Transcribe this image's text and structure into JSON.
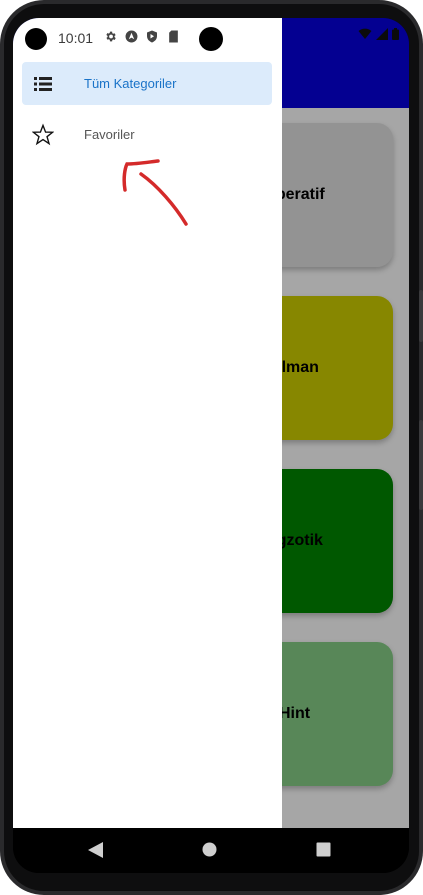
{
  "status_bar": {
    "time": "10:01",
    "left_icons": [
      "settings-icon",
      "navigation-icon",
      "shield-icon",
      "play-protect-icon",
      "sd-card-icon"
    ],
    "right_icons": [
      "wifi-icon",
      "signal-icon",
      "battery-icon"
    ]
  },
  "drawer": {
    "items": [
      {
        "label": "Tüm Kategoriler",
        "icon": "list-icon",
        "active": true
      },
      {
        "label": "Favoriler",
        "icon": "star-icon",
        "active": false
      }
    ]
  },
  "categories": [
    {
      "label": "Aperatif",
      "color": "#d9d9d9"
    },
    {
      "label": "Alman",
      "color": "#c8c800"
    },
    {
      "label": "Egzotik",
      "color": "#008200"
    },
    {
      "label": "Hint",
      "color": "#82c882"
    }
  ],
  "colors": {
    "app_bar": "#0600d6",
    "drawer_active_bg": "#dcebfb",
    "drawer_active_text": "#1a73c8",
    "annotation": "#d42a2a"
  },
  "system_nav": [
    "back-button",
    "home-button",
    "recents-button"
  ]
}
